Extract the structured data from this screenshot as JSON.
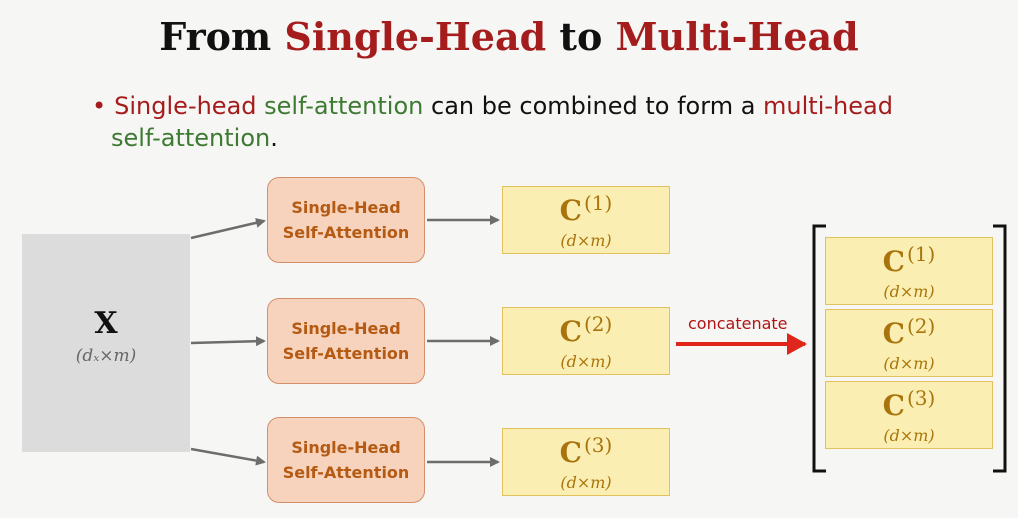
{
  "title": {
    "from": "From",
    "single_head": "Single-Head",
    "to": "to",
    "multi_head": "Multi-Head"
  },
  "bullet": {
    "part1": "Single-head",
    "part2": "self-attention",
    "part3": "can be combined to form a",
    "part4": "multi-head",
    "part5": "self-attention",
    "part6": "."
  },
  "input": {
    "label": "X",
    "dims": "(dₓ×m)"
  },
  "heads": [
    {
      "line1": "Single-Head",
      "line2": "Self-Attention"
    },
    {
      "line1": "Single-Head",
      "line2": "Self-Attention"
    },
    {
      "line1": "Single-Head",
      "line2": "Self-Attention"
    }
  ],
  "outputs": [
    {
      "label": "C",
      "sup": "(1)",
      "dims": "(d×m)"
    },
    {
      "label": "C",
      "sup": "(2)",
      "dims": "(d×m)"
    },
    {
      "label": "C",
      "sup": "(3)",
      "dims": "(d×m)"
    }
  ],
  "concat_label": "concatenate",
  "stacked": [
    {
      "label": "C",
      "sup": "(1)",
      "dims": "(d×m)"
    },
    {
      "label": "C",
      "sup": "(2)",
      "dims": "(d×m)"
    },
    {
      "label": "C",
      "sup": "(3)",
      "dims": "(d×m)"
    }
  ],
  "colors": {
    "title_red": "#a51c1c",
    "green": "#3d7a32",
    "head_fill": "#f7d3bd",
    "head_text": "#b45a12",
    "c_fill": "#fbeeb3",
    "c_text": "#a9740c",
    "concat_arrow": "#e0261b",
    "arrow_gray": "#6d6d6d"
  }
}
